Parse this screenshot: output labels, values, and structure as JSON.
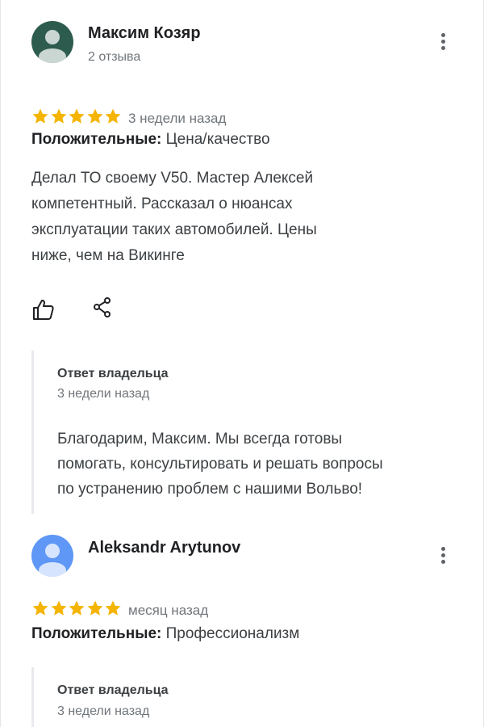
{
  "reviews": [
    {
      "author": "Максим Козяр",
      "author_meta": "2 отзыва",
      "avatar_color": "#2d5c4e",
      "rating": 5,
      "date": "3 недели назад",
      "positives_label": "Положительные:",
      "positives_value": "Цена/качество",
      "text_lines": [
        "Делал ТО своему V50. Мастер Алексей",
        "компетентный. Рассказал о нюансах",
        "эксплуатации таких автомобилей. Цены",
        "ниже, чем на Викинге"
      ],
      "actions": {
        "like_icon": "thumbs-up-icon",
        "share_icon": "share-icon"
      },
      "owner_reply": {
        "title": "Ответ владельца",
        "date": "3 недели назад",
        "text_lines": [
          "Благодарим, Максим. Мы всегда готовы",
          "помогать, консультировать и решать вопросы",
          "по устранению проблем с нашими Вольво!"
        ]
      }
    },
    {
      "author": "Aleksandr Arytunov",
      "avatar_color": "#5e97f6",
      "rating": 5,
      "date": "месяц назад",
      "positives_label": "Положительные:",
      "positives_value": "Профессионализм",
      "owner_reply": {
        "title": "Ответ владельца",
        "date": "3 недели назад"
      }
    }
  ],
  "colors": {
    "star": "#f4b400",
    "accent_text": "#202124",
    "muted_text": "#70757a",
    "reply_border": "#e8eaed"
  }
}
